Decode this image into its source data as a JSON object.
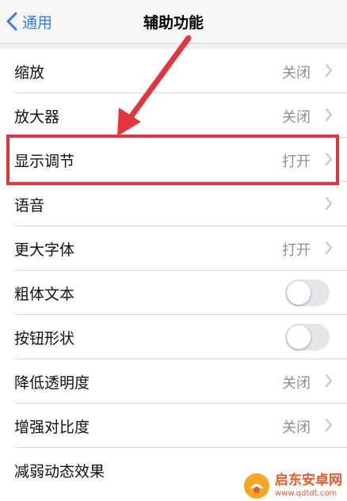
{
  "nav": {
    "back_label": "通用",
    "title": "辅助功能"
  },
  "rows": [
    {
      "label": "缩放",
      "value": "关闭",
      "type": "link"
    },
    {
      "label": "放大器",
      "value": "关闭",
      "type": "link"
    },
    {
      "label": "显示调节",
      "value": "打开",
      "type": "link",
      "highlighted": true
    },
    {
      "label": "语音",
      "value": "",
      "type": "link"
    },
    {
      "label": "更大字体",
      "value": "打开",
      "type": "link"
    },
    {
      "label": "粗体文本",
      "type": "toggle",
      "on": false
    },
    {
      "label": "按钮形状",
      "type": "toggle",
      "on": false
    },
    {
      "label": "降低透明度",
      "value": "关闭",
      "type": "link"
    },
    {
      "label": "增强对比度",
      "value": "关闭",
      "type": "link"
    },
    {
      "label": "减弱动态效果",
      "value": "",
      "type": "link"
    }
  ],
  "annotation": {
    "color": "#e3353f"
  },
  "watermark": {
    "name": "启东安卓网",
    "url": "www.qdtdt.com"
  },
  "colors": {
    "accent": "#2f7cf6",
    "highlight": "#e3353f",
    "secondary_text": "#8e8e93"
  }
}
